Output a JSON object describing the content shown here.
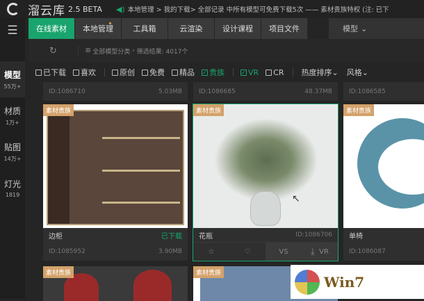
{
  "app": {
    "name": "溜云库",
    "version": "2.5 BETA",
    "notice": "本地管理 > 我的下载> 全部记录 中所有模型可免费下载5次  —— 素材贵族特权  (注: 已下"
  },
  "sidebar": [
    {
      "label": "模型",
      "count": "55万+"
    },
    {
      "label": "材质",
      "count": "1万+"
    },
    {
      "label": "贴图",
      "count": "14万+"
    },
    {
      "label": "灯光",
      "count": "1819"
    }
  ],
  "tabs": [
    "在线素材",
    "本地管理",
    "工具箱",
    "云渲染",
    "设计课程",
    "项目文件"
  ],
  "type_dropdown": "模型",
  "breadcrumb": {
    "category": "全部模型分类",
    "result": "筛选结果: 4017个"
  },
  "filters": [
    {
      "label": "已下载",
      "checked": false
    },
    {
      "label": "喜欢",
      "checked": false
    },
    {
      "label": "原创",
      "checked": false
    },
    {
      "label": "免费",
      "checked": false
    },
    {
      "label": "精品",
      "checked": false
    },
    {
      "label": "贵族",
      "checked": true
    },
    {
      "label": "VR",
      "checked": true
    },
    {
      "label": "CR",
      "checked": false
    }
  ],
  "sort": {
    "hot": "热度排序",
    "style": "风格"
  },
  "prev_row": [
    {
      "id": "ID:1086710",
      "size": "5.03MB"
    },
    {
      "id": "ID:1086685",
      "size": "48.37MB"
    },
    {
      "id": "ID:1086585",
      "size": ""
    }
  ],
  "badge": "素材贵族",
  "cards": [
    {
      "name": "边柜",
      "status": "已下载",
      "id": "ID:1085952",
      "size": "3.90MB"
    },
    {
      "name": "花瓶",
      "id": "ID:1086706",
      "vs": "VS",
      "vr": "VR"
    },
    {
      "name": "单椅",
      "id": "ID:1086087"
    }
  ],
  "watermark": "Win7"
}
